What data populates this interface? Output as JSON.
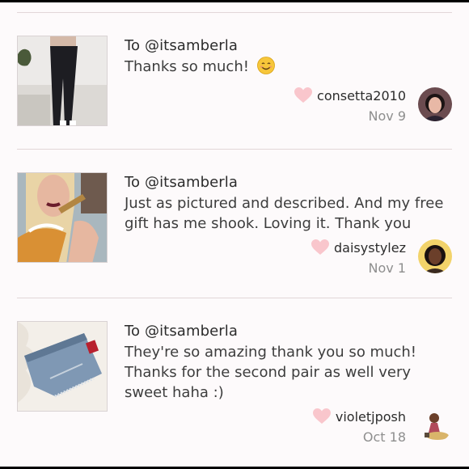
{
  "reviews": [
    {
      "to_line": "To @itsamberla",
      "message": "Thanks so much!",
      "emoji": "smiling-face-emoji",
      "username": "consetta2010",
      "date": "Nov 9",
      "thumb_icon": "leggings-photo"
    },
    {
      "to_line": "To @itsamberla",
      "message": "Just as pictured and described. And my free gift has me shook. Loving it. Thank you",
      "username": "daisystylez",
      "date": "Nov 1",
      "thumb_icon": "selfie-photo"
    },
    {
      "to_line": "To @itsamberla",
      "message": "They're so amazing thank you so much! Thanks for the second pair as well very sweet haha :)",
      "username": "violetjposh",
      "date": "Oct 18",
      "thumb_icon": "denim-shorts-photo"
    }
  ],
  "colors": {
    "heart": "#f9c6cc",
    "divider": "#e2d6d8",
    "date": "#8e8e8e"
  }
}
